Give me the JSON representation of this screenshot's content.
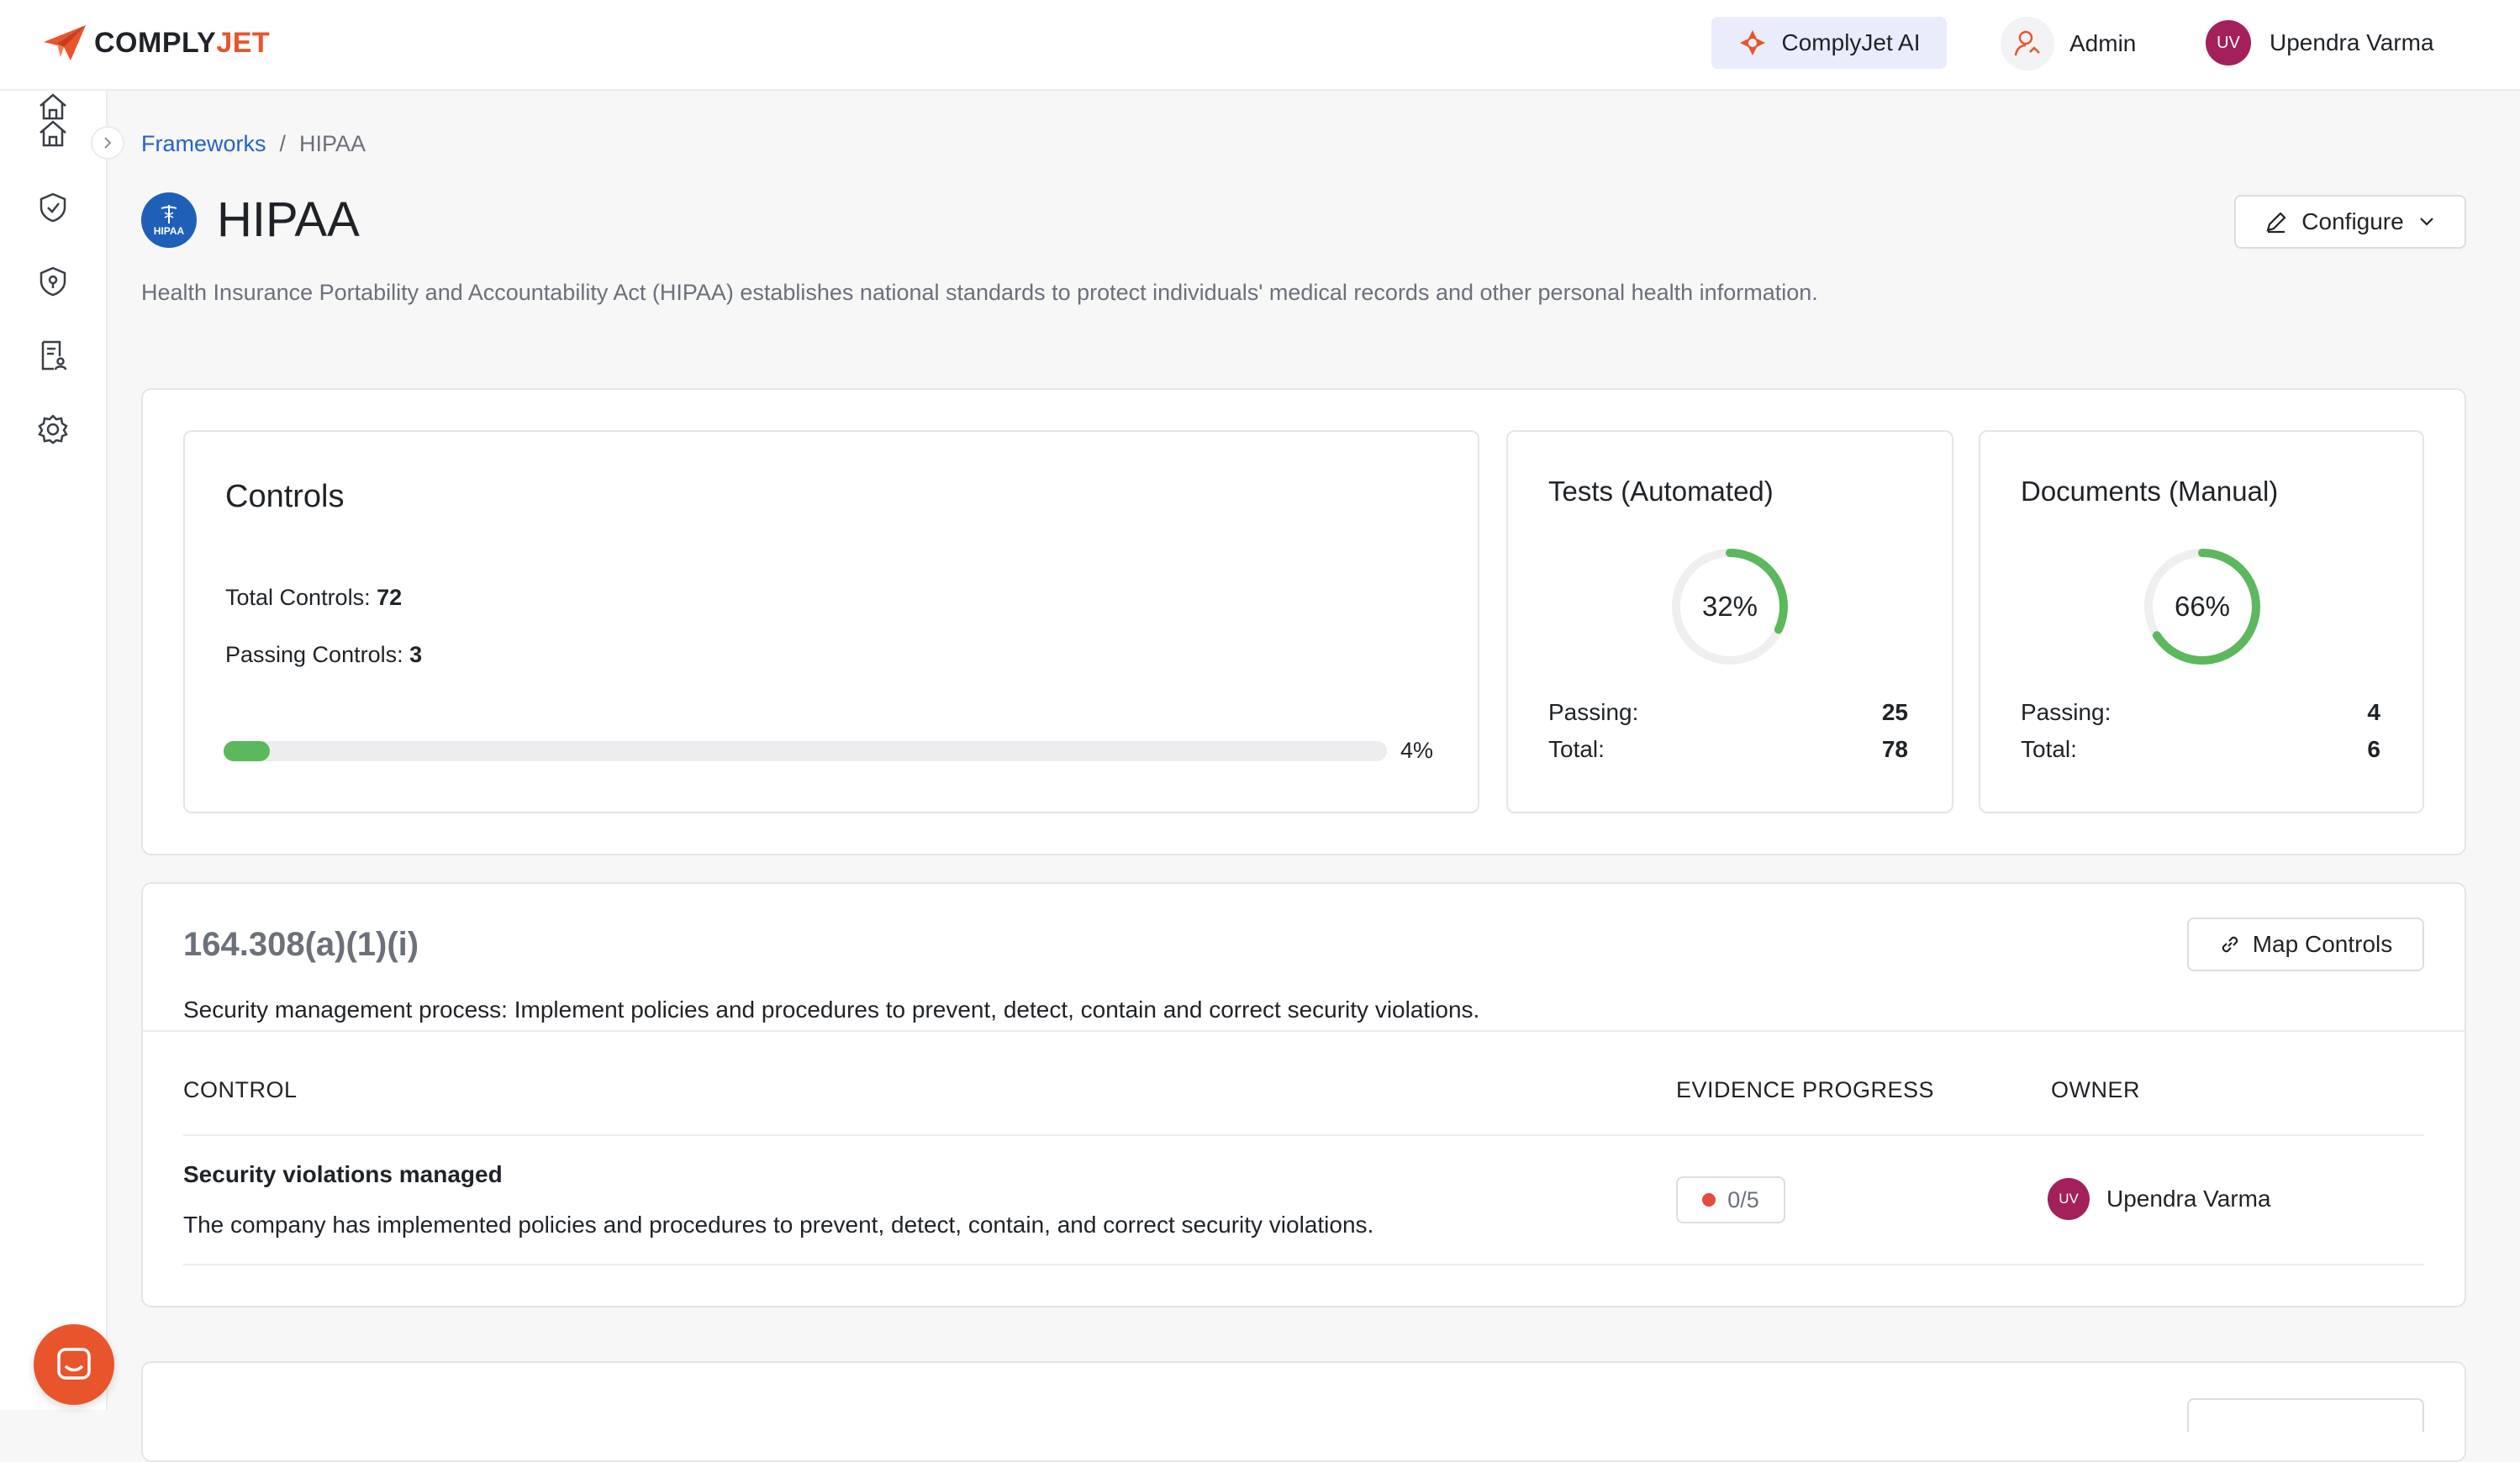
{
  "app": {
    "logo_main": "COMPLY",
    "logo_accent": "JET"
  },
  "header": {
    "ai_label": "ComplyJet AI",
    "admin_label": "Admin",
    "user_initials": "UV",
    "user_name": "Upendra Varma"
  },
  "breadcrumb": {
    "parent": "Frameworks",
    "separator": "/",
    "current": "HIPAA"
  },
  "framework": {
    "badge_text": "HIPAA",
    "title": "HIPAA",
    "configure_label": "Configure",
    "description": "Health Insurance Portability and Accountability Act (HIPAA) establishes national standards to protect individuals' medical records and other personal health information."
  },
  "controls": {
    "heading": "Controls",
    "total_label": "Total Controls:",
    "total_value": "72",
    "passing_label": "Passing Controls:",
    "passing_value": "3",
    "progress_pct": 4,
    "progress_text": "4%"
  },
  "tests": {
    "heading": "Tests (Automated)",
    "pct": 32,
    "pct_text": "32%",
    "passing_label": "Passing:",
    "passing_value": "25",
    "total_label": "Total:",
    "total_value": "78"
  },
  "documents": {
    "heading": "Documents (Manual)",
    "pct": 66,
    "pct_text": "66%",
    "passing_label": "Passing:",
    "passing_value": "4",
    "total_label": "Total:",
    "total_value": "6"
  },
  "section": {
    "id": "164.308(a)(1)(i)",
    "map_label": "Map Controls",
    "description": "Security management process: Implement policies and procedures to prevent, detect, contain and correct security violations.",
    "columns": {
      "control": "CONTROL",
      "evidence": "EVIDENCE PROGRESS",
      "owner": "OWNER"
    },
    "rows": [
      {
        "title": "Security violations managed",
        "description": "The company has implemented policies and procedures to prevent, detect, contain, and correct security violations.",
        "evidence": "0/5",
        "owner_initials": "UV",
        "owner_name": "Upendra Varma"
      }
    ]
  },
  "colors": {
    "accent": "#e8552d",
    "pass": "#5cb85c",
    "fail": "#e24c3f",
    "link": "#2463c5",
    "avatar": "#a3205a"
  }
}
